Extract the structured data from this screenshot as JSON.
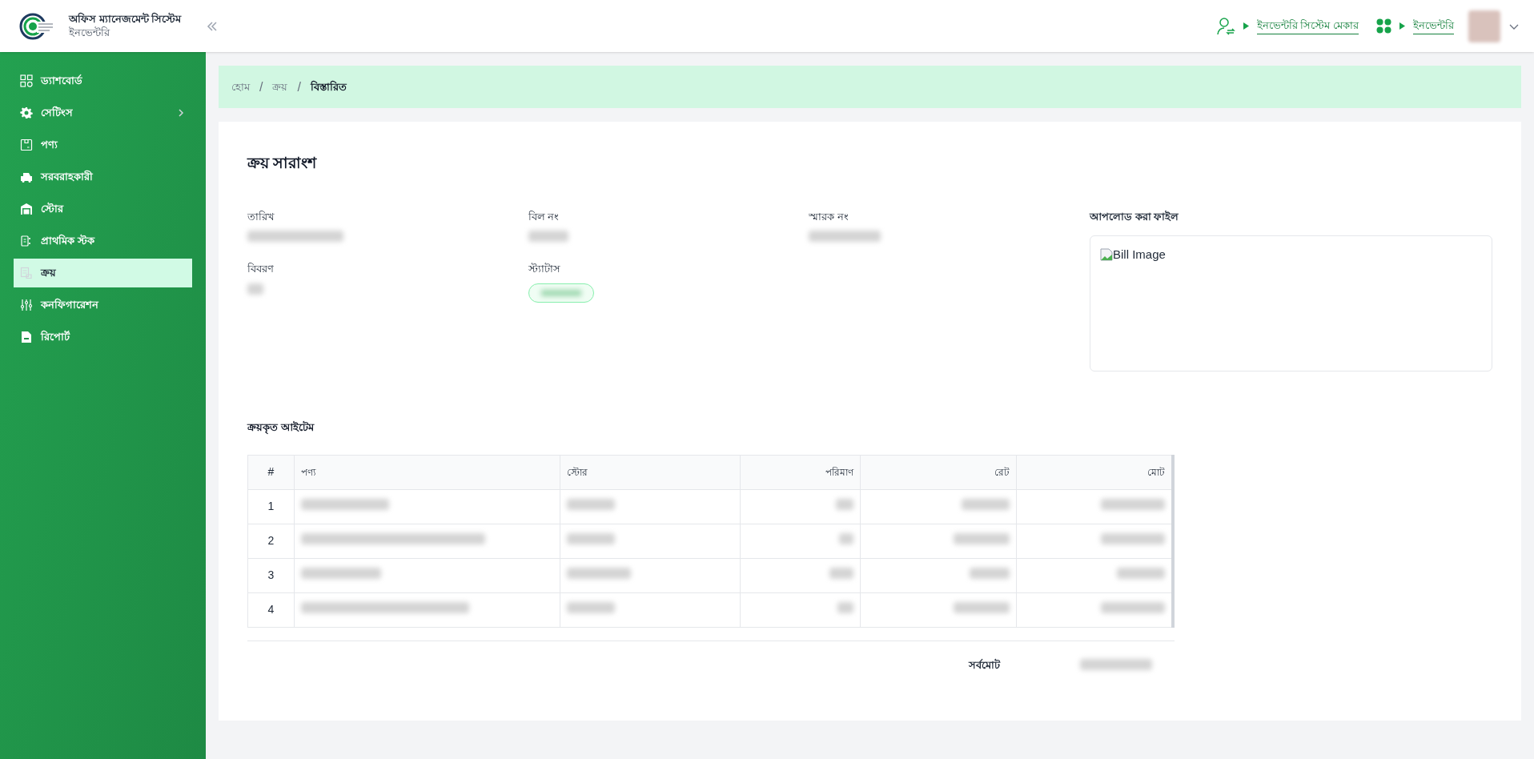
{
  "header": {
    "app_title": "অফিস ম্যানেজমেন্ট সিস্টেম",
    "app_subtitle": "ইনভেন্টরি",
    "role_link": "ইনভেন্টরি সিস্টেম মেকার",
    "module_link": "ইনভেন্টরি"
  },
  "sidebar": {
    "items": [
      {
        "label": "ড্যাশবোর্ড",
        "selected": false,
        "expandable": false
      },
      {
        "label": "সেটিংস",
        "selected": false,
        "expandable": true
      },
      {
        "label": "পণ্য",
        "selected": false,
        "expandable": false
      },
      {
        "label": "সরবরাহকারী",
        "selected": false,
        "expandable": false
      },
      {
        "label": "স্টোর",
        "selected": false,
        "expandable": false
      },
      {
        "label": "প্রাথমিক স্টক",
        "selected": false,
        "expandable": false
      },
      {
        "label": "ক্রয়",
        "selected": true,
        "expandable": false
      },
      {
        "label": "কনফিগারেশন",
        "selected": false,
        "expandable": false
      },
      {
        "label": "রিপোর্ট",
        "selected": false,
        "expandable": false
      }
    ]
  },
  "breadcrumb": {
    "separators": [
      "/",
      "/"
    ],
    "items": [
      {
        "label": "হোম",
        "current": false
      },
      {
        "label": "ক্রয়",
        "current": false
      },
      {
        "label": "বিস্তারিত",
        "current": true
      }
    ]
  },
  "summary": {
    "title": "ক্রয় সারাংশ",
    "fields": [
      {
        "label": "তারিখ",
        "kind": "text"
      },
      {
        "label": "বিল নং",
        "kind": "text"
      },
      {
        "label": "স্মারক নং",
        "kind": "text"
      },
      {
        "label": "বিবরণ",
        "kind": "text"
      },
      {
        "label": "স্ট্যাটাস",
        "kind": "badge"
      }
    ],
    "upload_label": "আপলোড করা ফাইল",
    "image_alt": "Bill Image"
  },
  "items": {
    "title": "ক্রয়কৃত আইটেম",
    "columns": [
      "#",
      "পণ্য",
      "স্টোর",
      "পরিমাণ",
      "রেট",
      "মোট"
    ],
    "rows": [
      {
        "index": "1"
      },
      {
        "index": "2"
      },
      {
        "index": "3"
      },
      {
        "index": "4"
      }
    ],
    "grand_total_label": "সর্বমোট"
  }
}
